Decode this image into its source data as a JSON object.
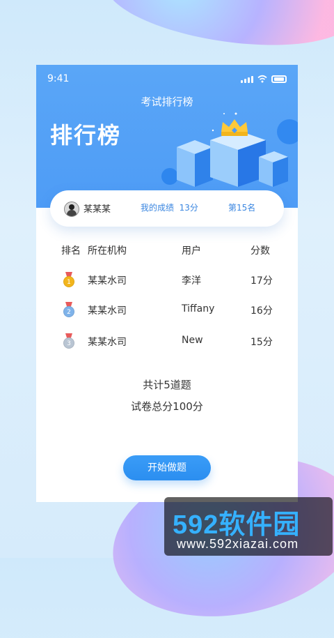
{
  "status_bar": {
    "time": "9:41"
  },
  "header": {
    "nav_title": "考试排行榜",
    "big_title": "排行榜"
  },
  "summary_card": {
    "username": "某某某",
    "my_score_label": "我的成绩",
    "my_score_value": "13分",
    "rank_text": "第15名"
  },
  "table": {
    "headers": {
      "rank": "排名",
      "org": "所在机构",
      "user": "用户",
      "score": "分数"
    },
    "rows": [
      {
        "medal_number": "1",
        "org": "某某水司",
        "user": "李洋",
        "score": "17分"
      },
      {
        "medal_number": "2",
        "org": "某某水司",
        "user": "Tiffany",
        "score": "16分"
      },
      {
        "medal_number": "3",
        "org": "某某水司",
        "user": "New",
        "score": "15分"
      }
    ]
  },
  "quiz_info": {
    "total_questions": "共计5道题",
    "total_score": "试卷总分100分"
  },
  "actions": {
    "start_button": "开始做题"
  },
  "watermark": {
    "logo_text": "592软件园",
    "url": "www.592xiazai.com"
  },
  "colors": {
    "primary": "#4e9cf6",
    "accent_text": "#3a86e0",
    "button": "#2b8ef0",
    "medal_gold": "#f2b51c"
  }
}
